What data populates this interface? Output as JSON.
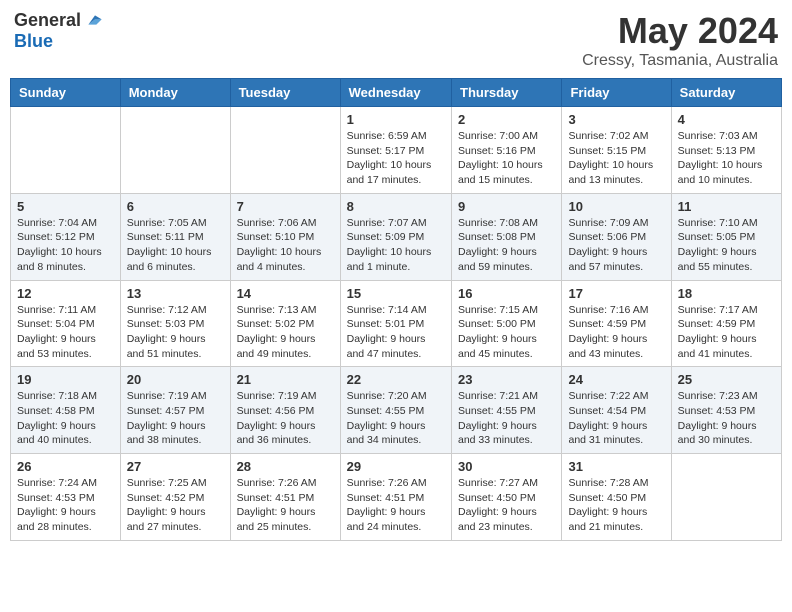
{
  "header": {
    "logo_general": "General",
    "logo_blue": "Blue",
    "month": "May 2024",
    "location": "Cressy, Tasmania, Australia"
  },
  "weekdays": [
    "Sunday",
    "Monday",
    "Tuesday",
    "Wednesday",
    "Thursday",
    "Friday",
    "Saturday"
  ],
  "rows": [
    [
      {
        "day": "",
        "info": ""
      },
      {
        "day": "",
        "info": ""
      },
      {
        "day": "",
        "info": ""
      },
      {
        "day": "1",
        "info": "Sunrise: 6:59 AM\nSunset: 5:17 PM\nDaylight: 10 hours\nand 17 minutes."
      },
      {
        "day": "2",
        "info": "Sunrise: 7:00 AM\nSunset: 5:16 PM\nDaylight: 10 hours\nand 15 minutes."
      },
      {
        "day": "3",
        "info": "Sunrise: 7:02 AM\nSunset: 5:15 PM\nDaylight: 10 hours\nand 13 minutes."
      },
      {
        "day": "4",
        "info": "Sunrise: 7:03 AM\nSunset: 5:13 PM\nDaylight: 10 hours\nand 10 minutes."
      }
    ],
    [
      {
        "day": "5",
        "info": "Sunrise: 7:04 AM\nSunset: 5:12 PM\nDaylight: 10 hours\nand 8 minutes."
      },
      {
        "day": "6",
        "info": "Sunrise: 7:05 AM\nSunset: 5:11 PM\nDaylight: 10 hours\nand 6 minutes."
      },
      {
        "day": "7",
        "info": "Sunrise: 7:06 AM\nSunset: 5:10 PM\nDaylight: 10 hours\nand 4 minutes."
      },
      {
        "day": "8",
        "info": "Sunrise: 7:07 AM\nSunset: 5:09 PM\nDaylight: 10 hours\nand 1 minute."
      },
      {
        "day": "9",
        "info": "Sunrise: 7:08 AM\nSunset: 5:08 PM\nDaylight: 9 hours\nand 59 minutes."
      },
      {
        "day": "10",
        "info": "Sunrise: 7:09 AM\nSunset: 5:06 PM\nDaylight: 9 hours\nand 57 minutes."
      },
      {
        "day": "11",
        "info": "Sunrise: 7:10 AM\nSunset: 5:05 PM\nDaylight: 9 hours\nand 55 minutes."
      }
    ],
    [
      {
        "day": "12",
        "info": "Sunrise: 7:11 AM\nSunset: 5:04 PM\nDaylight: 9 hours\nand 53 minutes."
      },
      {
        "day": "13",
        "info": "Sunrise: 7:12 AM\nSunset: 5:03 PM\nDaylight: 9 hours\nand 51 minutes."
      },
      {
        "day": "14",
        "info": "Sunrise: 7:13 AM\nSunset: 5:02 PM\nDaylight: 9 hours\nand 49 minutes."
      },
      {
        "day": "15",
        "info": "Sunrise: 7:14 AM\nSunset: 5:01 PM\nDaylight: 9 hours\nand 47 minutes."
      },
      {
        "day": "16",
        "info": "Sunrise: 7:15 AM\nSunset: 5:00 PM\nDaylight: 9 hours\nand 45 minutes."
      },
      {
        "day": "17",
        "info": "Sunrise: 7:16 AM\nSunset: 4:59 PM\nDaylight: 9 hours\nand 43 minutes."
      },
      {
        "day": "18",
        "info": "Sunrise: 7:17 AM\nSunset: 4:59 PM\nDaylight: 9 hours\nand 41 minutes."
      }
    ],
    [
      {
        "day": "19",
        "info": "Sunrise: 7:18 AM\nSunset: 4:58 PM\nDaylight: 9 hours\nand 40 minutes."
      },
      {
        "day": "20",
        "info": "Sunrise: 7:19 AM\nSunset: 4:57 PM\nDaylight: 9 hours\nand 38 minutes."
      },
      {
        "day": "21",
        "info": "Sunrise: 7:19 AM\nSunset: 4:56 PM\nDaylight: 9 hours\nand 36 minutes."
      },
      {
        "day": "22",
        "info": "Sunrise: 7:20 AM\nSunset: 4:55 PM\nDaylight: 9 hours\nand 34 minutes."
      },
      {
        "day": "23",
        "info": "Sunrise: 7:21 AM\nSunset: 4:55 PM\nDaylight: 9 hours\nand 33 minutes."
      },
      {
        "day": "24",
        "info": "Sunrise: 7:22 AM\nSunset: 4:54 PM\nDaylight: 9 hours\nand 31 minutes."
      },
      {
        "day": "25",
        "info": "Sunrise: 7:23 AM\nSunset: 4:53 PM\nDaylight: 9 hours\nand 30 minutes."
      }
    ],
    [
      {
        "day": "26",
        "info": "Sunrise: 7:24 AM\nSunset: 4:53 PM\nDaylight: 9 hours\nand 28 minutes."
      },
      {
        "day": "27",
        "info": "Sunrise: 7:25 AM\nSunset: 4:52 PM\nDaylight: 9 hours\nand 27 minutes."
      },
      {
        "day": "28",
        "info": "Sunrise: 7:26 AM\nSunset: 4:51 PM\nDaylight: 9 hours\nand 25 minutes."
      },
      {
        "day": "29",
        "info": "Sunrise: 7:26 AM\nSunset: 4:51 PM\nDaylight: 9 hours\nand 24 minutes."
      },
      {
        "day": "30",
        "info": "Sunrise: 7:27 AM\nSunset: 4:50 PM\nDaylight: 9 hours\nand 23 minutes."
      },
      {
        "day": "31",
        "info": "Sunrise: 7:28 AM\nSunset: 4:50 PM\nDaylight: 9 hours\nand 21 minutes."
      },
      {
        "day": "",
        "info": ""
      }
    ]
  ]
}
